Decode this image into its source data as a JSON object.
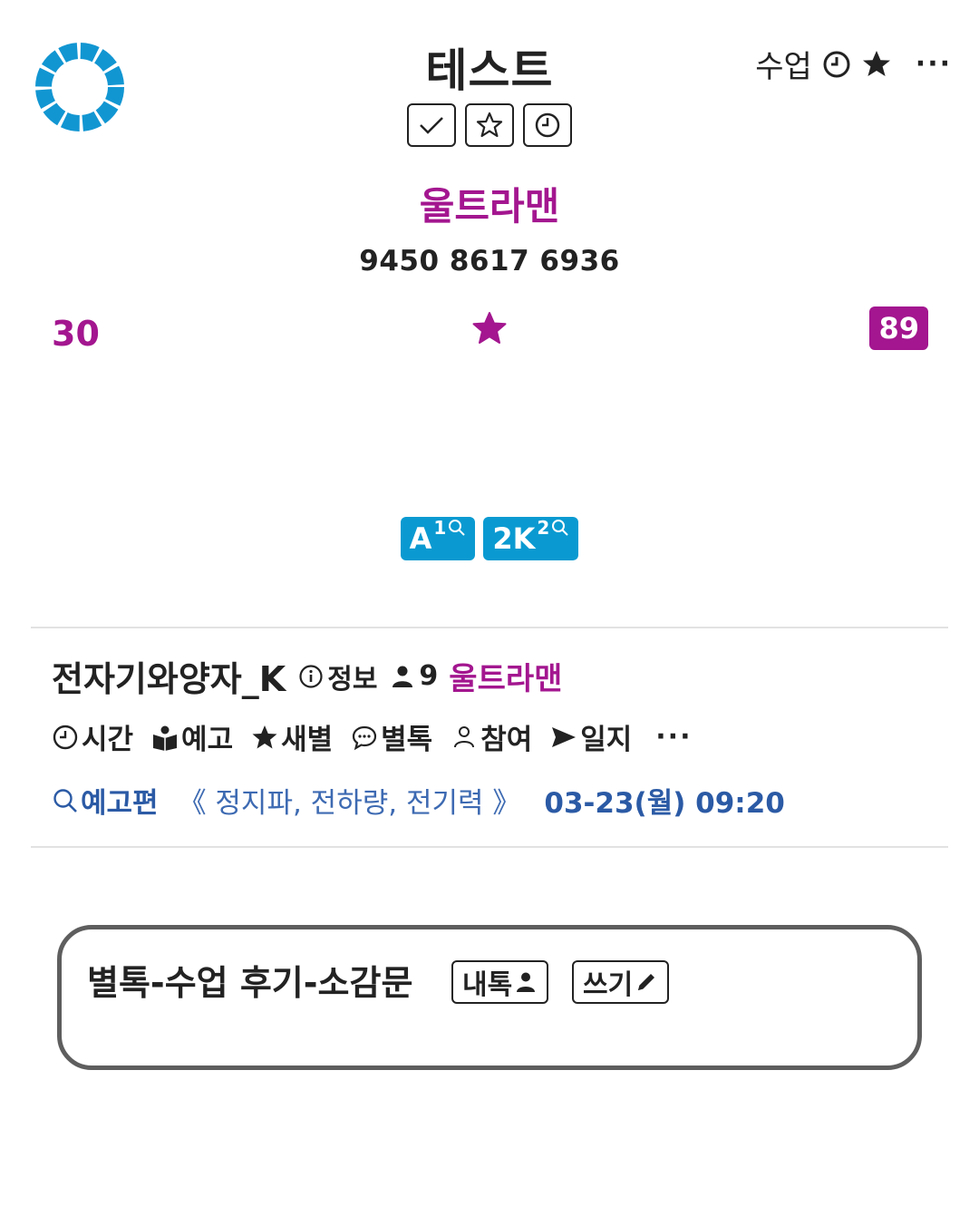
{
  "header": {
    "title": "테스트",
    "top_right_label": "수업",
    "more_label": "···",
    "status_icons": [
      "check-icon",
      "star-outline-icon",
      "clock-icon"
    ]
  },
  "teacher_name": "울트라맨",
  "room_code": "9450 8617 6936",
  "count_left": "30",
  "badge_right": "89",
  "chips": [
    {
      "label": "A",
      "sup": "1"
    },
    {
      "label": "2K",
      "sup": "2"
    }
  ],
  "room": {
    "name": "전자기와양자_K",
    "info_label": "정보",
    "member_count": "9",
    "teacher": "울트라맨"
  },
  "menu": [
    {
      "label": "시간",
      "icon": "clock-icon"
    },
    {
      "label": "예고",
      "icon": "book-icon"
    },
    {
      "label": "새별",
      "icon": "star-icon"
    },
    {
      "label": "별톡",
      "icon": "chat-icon"
    },
    {
      "label": "참여",
      "icon": "person-outline-icon"
    },
    {
      "label": "일지",
      "icon": "send-icon"
    }
  ],
  "menu_more": "···",
  "preview": {
    "label": "예고편",
    "topic": "《 정지파, 전하량, 전기력 》",
    "date": "03-23(월) 09:20"
  },
  "review": {
    "title": "별톡-수업 후기-소감문",
    "inner_talk_label": "내톡",
    "write_label": "쓰기"
  },
  "colors": {
    "accent": "#a3168f",
    "chip": "#0a9ad1",
    "link": "#2b5aa5",
    "logo": "#1296d2"
  }
}
